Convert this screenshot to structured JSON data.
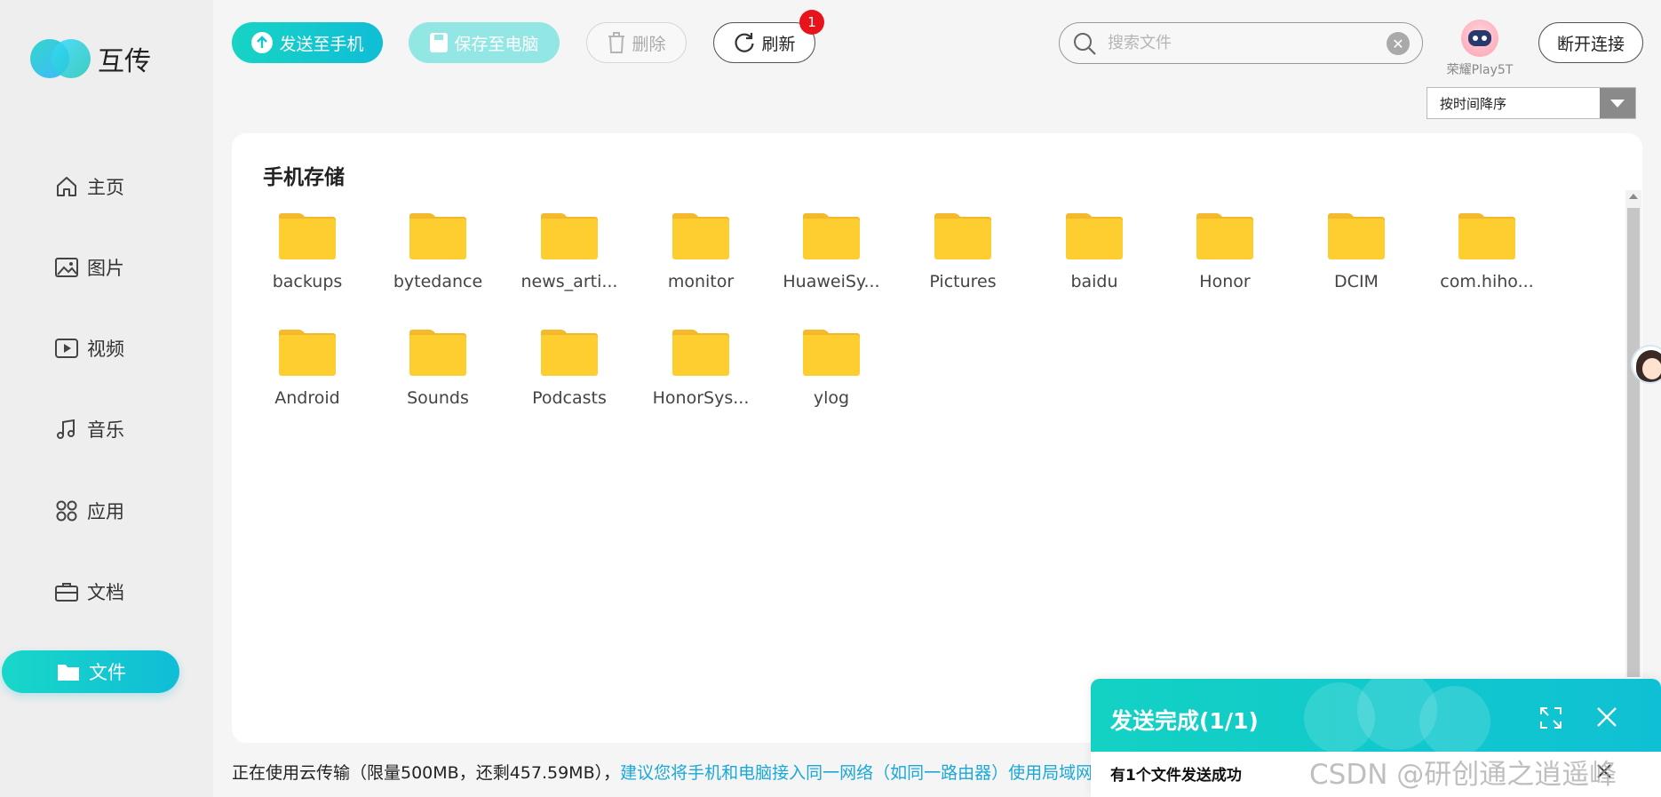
{
  "app": {
    "title": "互传"
  },
  "sidebar": {
    "items": [
      {
        "label": "主页",
        "icon": "home-icon"
      },
      {
        "label": "图片",
        "icon": "image-icon"
      },
      {
        "label": "视频",
        "icon": "video-icon"
      },
      {
        "label": "音乐",
        "icon": "music-icon"
      },
      {
        "label": "应用",
        "icon": "apps-icon"
      },
      {
        "label": "文档",
        "icon": "briefcase-icon"
      },
      {
        "label": "文件",
        "icon": "folder-icon",
        "active": true
      }
    ]
  },
  "toolbar": {
    "send_label": "发送至手机",
    "save_label": "保存至电脑",
    "delete_label": "删除",
    "refresh_label": "刷新",
    "refresh_badge": "1",
    "disconnect_label": "断开连接"
  },
  "search": {
    "placeholder": "搜索文件",
    "value": ""
  },
  "device": {
    "name": "荣耀Play5T"
  },
  "sort": {
    "selected": "按时间降序"
  },
  "panel": {
    "title": "手机存储",
    "files": [
      "backups",
      "bytedance",
      "news_arti...",
      "monitor",
      "HuaweiSy...",
      "Pictures",
      "baidu",
      "Honor",
      "DCIM",
      "com.hiho...",
      "Android",
      "Sounds",
      "Podcasts",
      "HonorSys...",
      "ylog"
    ]
  },
  "footer": {
    "status": "正在使用云传输（限量500MB，还剩457.59MB），",
    "suggestion": "建议您将手机和电脑接入同一网络（如同一路由器）使用局域网传"
  },
  "toast": {
    "title": "发送完成(1/1)",
    "message": "有1个文件发送成功"
  },
  "watermark": "CSDN @研创通之逍遥峰",
  "colors": {
    "accent": "#13d2c3",
    "folder": "#fece31",
    "badge": "#e8141b",
    "link": "#1ba8d8"
  }
}
